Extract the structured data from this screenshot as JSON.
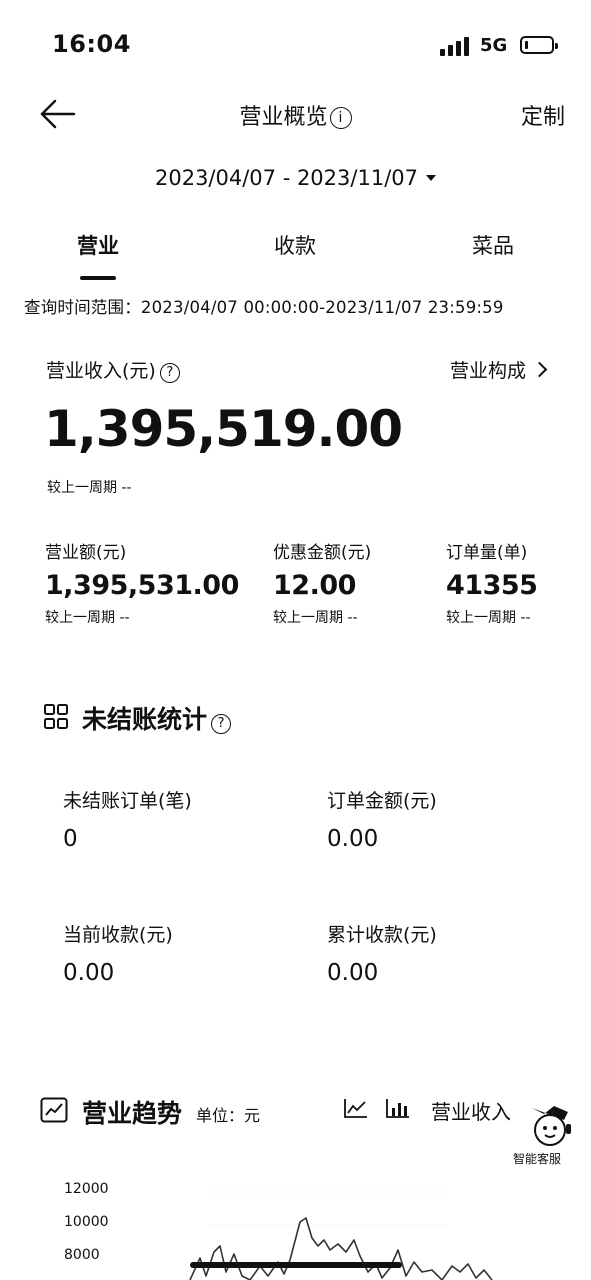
{
  "status_bar": {
    "time": "16:04",
    "network": "5G"
  },
  "nav": {
    "title": "营业概览",
    "info_glyph": "i",
    "customize": "定制"
  },
  "date_range": "2023/04/07 - 2023/11/07",
  "tabs": [
    {
      "label": "营业",
      "active": true
    },
    {
      "label": "收款",
      "active": false
    },
    {
      "label": "菜品",
      "active": false
    }
  ],
  "query_range": "查询时间范围：2023/04/07 00:00:00-2023/11/07 23:59:59",
  "revenue": {
    "label": "营业收入(元)",
    "help": "?",
    "composition_link": "营业构成",
    "value": "1,395,519.00",
    "compare": "较上一周期 --"
  },
  "metrics": [
    {
      "label": "营业额(元)",
      "value": "1,395,531.00",
      "compare": "较上一周期 --"
    },
    {
      "label": "优惠金额(元)",
      "value": "12.00",
      "compare": "较上一周期 --"
    },
    {
      "label": "订单量(单)",
      "value": "41355",
      "compare": "较上一周期 --"
    }
  ],
  "unsettled": {
    "title": "未结账统计",
    "help": "?",
    "items": [
      {
        "label": "未结账订单(笔)",
        "value": "0"
      },
      {
        "label": "订单金额(元)",
        "value": "0.00"
      },
      {
        "label": "当前收款(元)",
        "value": "0.00"
      },
      {
        "label": "累计收款(元)",
        "value": "0.00"
      }
    ]
  },
  "trend": {
    "title": "营业趋势",
    "unit": "单位：元",
    "metric": "营业收入",
    "assistant_label": "智能客服",
    "icons": [
      "line-chart-icon",
      "bar-chart-icon"
    ]
  },
  "chart_data": {
    "type": "line",
    "y_ticks": [
      "12000",
      "10000",
      "8000"
    ],
    "ylim": [
      7000,
      13000
    ]
  }
}
